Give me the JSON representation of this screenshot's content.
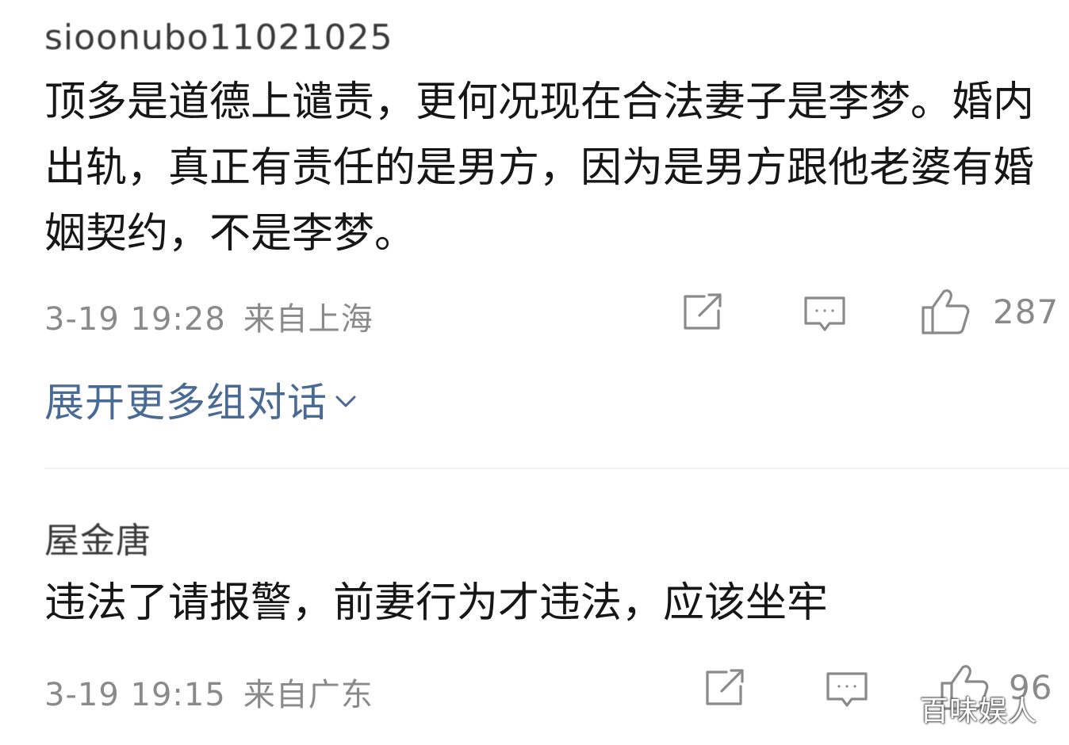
{
  "comments": [
    {
      "username": "sioonubo11021025",
      "text": "顶多是道德上谴责，更何况现在合法妻子是李梦。婚内出轨，真正有责任的是男方，因为是男方跟他老婆有婚姻契约，不是李梦。",
      "time": "3-19 19:28",
      "location": "来自上海",
      "likes": "287"
    },
    {
      "username": "屋金唐",
      "text": "违法了请报警，前妻行为才违法，应该坐牢",
      "time": "3-19 19:15",
      "location": "来自广东",
      "likes": "96"
    }
  ],
  "expand_label": "展开更多组对话",
  "watermark": "百味娱人",
  "colors": {
    "text": "#161616",
    "meta": "#8a8a8a",
    "link": "#4a6a96",
    "background": "#ffffff"
  },
  "icons": {
    "share": "share-icon",
    "reply": "comment-icon",
    "like": "thumbs-up-icon",
    "expand": "chevron-down-icon"
  }
}
